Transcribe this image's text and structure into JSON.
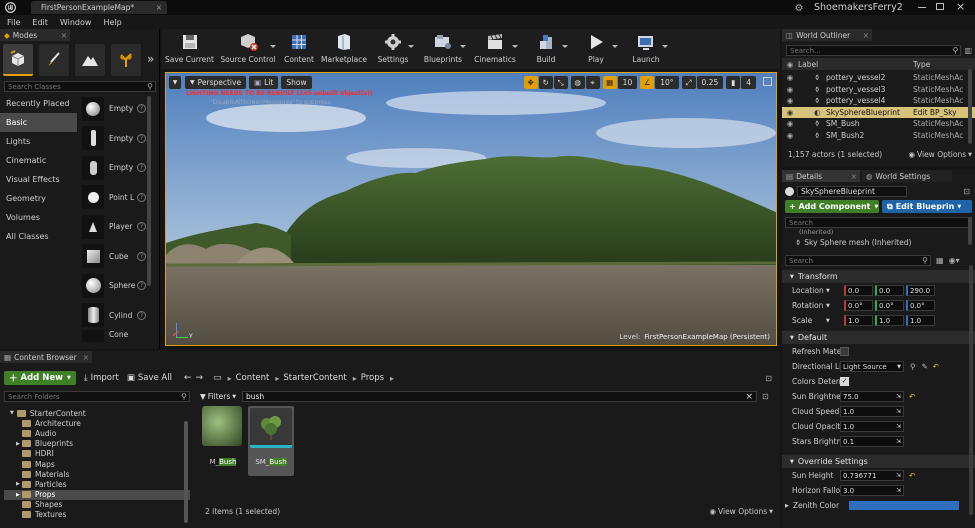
{
  "titlebar": {
    "tab": "FirstPersonExampleMap*",
    "project": "ShoemakersFerry2"
  },
  "menu": [
    "File",
    "Edit",
    "Window",
    "Help"
  ],
  "modes": {
    "tab": "Modes",
    "search_placeholder": "Search Classes",
    "categories": [
      "Recently Placed",
      "Basic",
      "Lights",
      "Cinematic",
      "Visual Effects",
      "Geometry",
      "Volumes",
      "All Classes"
    ],
    "assets": [
      "Empty",
      "Empty",
      "Empty",
      "Point L",
      "Player",
      "Cube",
      "Sphere",
      "Cylind",
      "Cone"
    ]
  },
  "toolbar": {
    "buttons": [
      "Save Current",
      "Source Control",
      "Content",
      "Marketplace",
      "Settings",
      "Blueprints",
      "Cinematics",
      "Build",
      "Play",
      "Launch"
    ]
  },
  "viewport": {
    "perspective": "Perspective",
    "lit": "Lit",
    "show": "Show",
    "warning": "LIGHTING NEEDS TO BE REBUILT (245 unbuilt object(s))",
    "suppressed": "'DisableAllScreenMessages' to suppress",
    "level_label": "Level:",
    "level_name": "FirstPersonExampleMap (Persistent)",
    "grid": "10",
    "angle": "10°",
    "scale": "0.25",
    "cam": "4",
    "axis_y": "Y"
  },
  "outliner": {
    "tab": "World Outliner",
    "search_placeholder": "Search...",
    "col_label": "Label",
    "col_type": "Type",
    "rows": [
      {
        "label": "pottery_vessel2",
        "type": "StaticMeshAc"
      },
      {
        "label": "pottery_vessel3",
        "type": "StaticMeshAc"
      },
      {
        "label": "pottery_vessel4",
        "type": "StaticMeshAc"
      },
      {
        "label": "SkySphereBlueprint",
        "type": "Edit BP_Sky"
      },
      {
        "label": "SM_Bush",
        "type": "StaticMeshAc"
      },
      {
        "label": "SM_Bush2",
        "type": "StaticMeshAc"
      }
    ],
    "status": "1,157 actors (1 selected)",
    "view_options": "View Options"
  },
  "details": {
    "tab": "Details",
    "tab2": "World Settings",
    "actor_name": "SkySphereBlueprint",
    "add_component": "+ Add Component",
    "edit_blueprint": "Edit Blueprin",
    "search_placeholder": "Search",
    "component_inherited": "(Inherited)",
    "component": "Sky Sphere mesh (Inherited)",
    "search2_placeholder": "Search",
    "transform": "Transform",
    "location_label": "Location",
    "location": [
      "0.0",
      "0.0",
      "290.0"
    ],
    "rotation_label": "Rotation",
    "rotation": [
      "0.0°",
      "0.0°",
      "0.0°"
    ],
    "scale_label": "Scale",
    "scale": [
      "1.0",
      "1.0",
      "1.0"
    ],
    "default": "Default",
    "refresh_material": "Refresh Materia",
    "directional_light": "Directional Light",
    "directional_value": "Light Source",
    "colors_determined": "Colors Determin",
    "sun_brightness_label": "Sun Brightness",
    "sun_brightness": "75.0",
    "cloud_speed_label": "Cloud Speed",
    "cloud_speed": "1.0",
    "cloud_opacity_label": "Cloud Opacity",
    "cloud_opacity": "1.0",
    "stars_brightness_label": "Stars Brightness",
    "stars_brightness": "0.1",
    "override": "Override Settings",
    "sun_height_label": "Sun Height",
    "sun_height": "0.736771",
    "horizon_falloff_label": "Horizon Falloff",
    "horizon_falloff": "3.0",
    "zenith_color_label": "Zenith Color"
  },
  "content_browser": {
    "tab": "Content Browser",
    "add_new": "Add New",
    "import": "Import",
    "save_all": "Save All",
    "path": [
      "Content",
      "StarterContent",
      "Props"
    ],
    "folder_search_placeholder": "Search Folders",
    "filters": "Filters",
    "search_value": "bush",
    "folders": [
      "StarterContent",
      "Architecture",
      "Audio",
      "Blueprints",
      "HDRI",
      "Maps",
      "Materials",
      "Particles",
      "Props",
      "Shapes",
      "Textures"
    ],
    "assets": [
      {
        "prefix": "M_",
        "match": "Bush"
      },
      {
        "prefix": "SM_",
        "match": "Bush"
      }
    ],
    "status": "2 items (1 selected)",
    "view_options": "View Options"
  },
  "colors": {
    "accent": "#e0a000",
    "select": "#d8c37a",
    "green": "#3f7f26",
    "blue": "#1f63a8"
  }
}
